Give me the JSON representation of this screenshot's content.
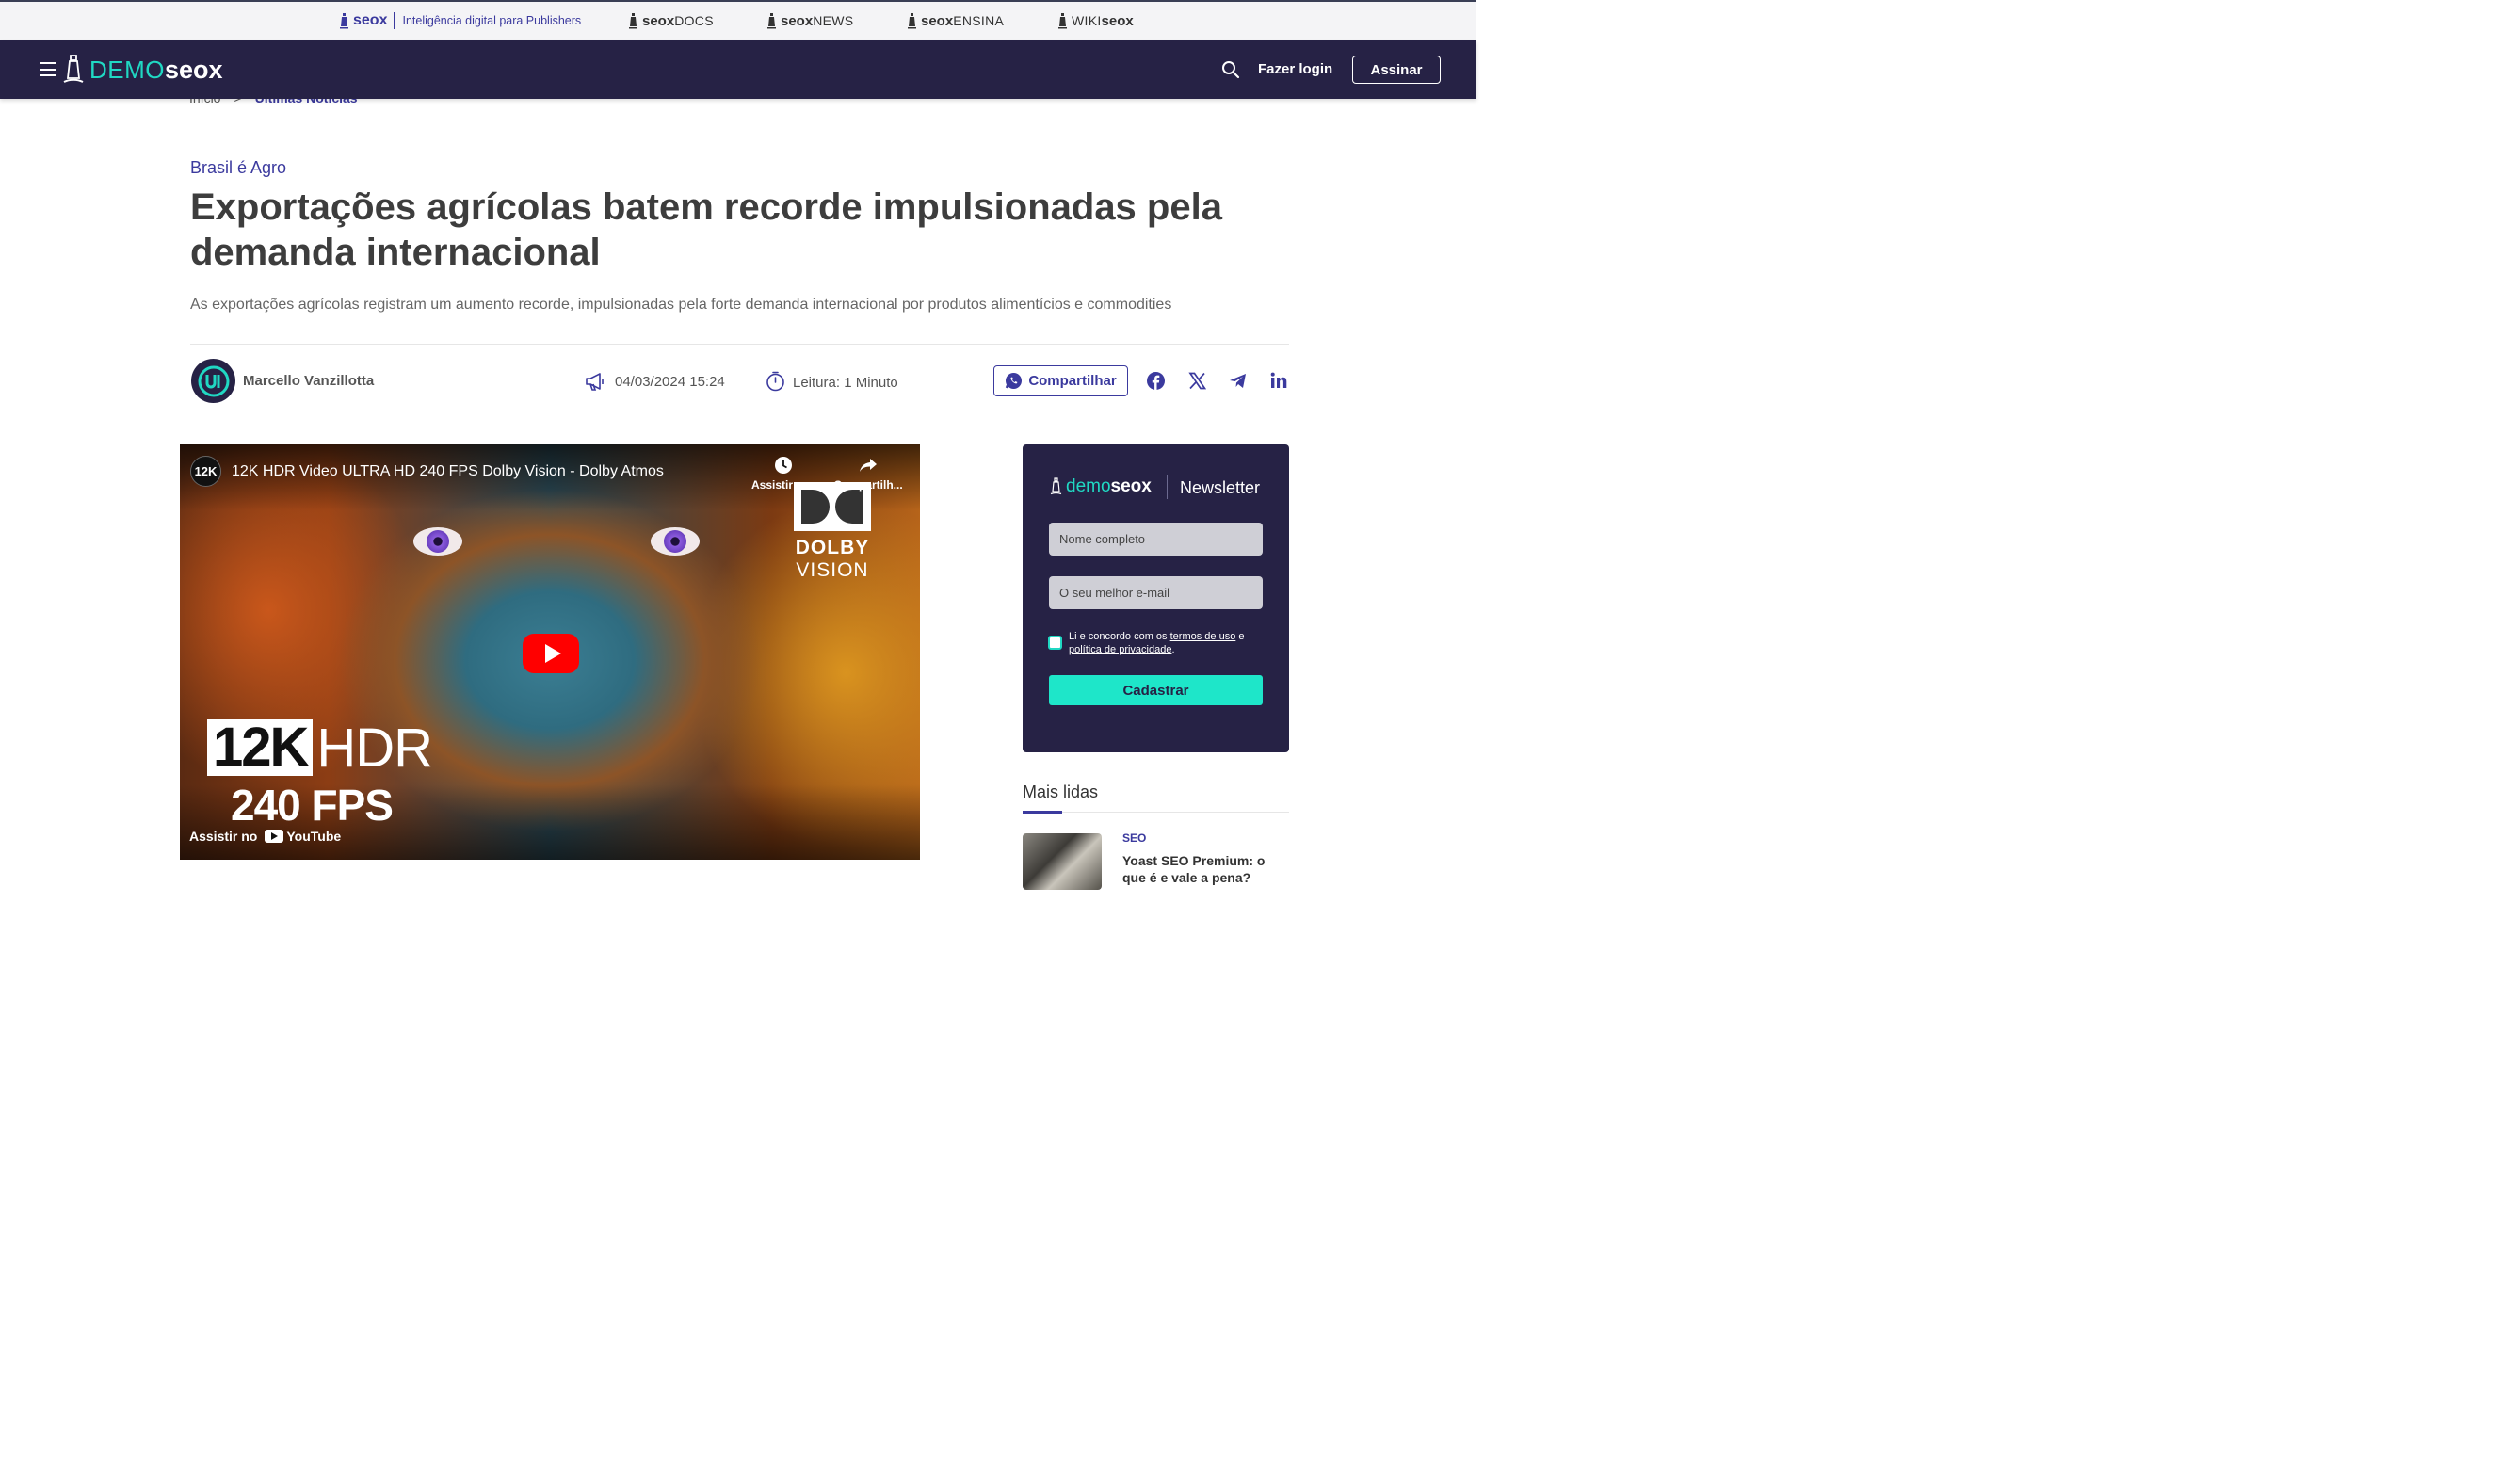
{
  "network_bar": {
    "main_brand": "seox",
    "main_tagline": "Inteligência digital para Publishers",
    "items": [
      {
        "brand": "seox",
        "suffix": "DOCS"
      },
      {
        "brand": "seox",
        "suffix": "NEWS"
      },
      {
        "brand": "seox",
        "suffix": "ENSINA"
      },
      {
        "prefix": "WIKI",
        "brand": "seox"
      }
    ]
  },
  "header": {
    "logo_demo": "DEMO",
    "logo_seox": "seox",
    "login_label": "Fazer login",
    "subscribe_label": "Assinar",
    "icons": [
      "menu-icon",
      "search-icon"
    ]
  },
  "breadcrumb": {
    "home": "Início",
    "separator": ">",
    "current": "Últimas Notícias"
  },
  "article": {
    "category": "Brasil é Agro",
    "title": "Exportações agrícolas batem recorde impulsionadas pela demanda internacional",
    "subtitle": "As exportações agrícolas registram um aumento recorde, impulsionadas pela forte demanda internacional por produtos alimentícios e commodities",
    "author": "Marcello Vanzillotta",
    "datetime": "04/03/2024 15:24",
    "reading_time": "Leitura: 1 Minuto",
    "share_label": "Compartilhar",
    "social_icons": [
      "facebook-icon",
      "x-icon",
      "telegram-icon",
      "linkedin-icon"
    ]
  },
  "video": {
    "channel_badge": "12K",
    "title": "12K HDR Video ULTRA HD 240 FPS Dolby Vision - Dolby Atmos",
    "watch_later_label": "Assistir m...",
    "share_label": "Compartilh...",
    "dolby_line1": "DOLBY",
    "dolby_line2": "VISION",
    "overlay_12k": "12K",
    "overlay_hdr": "HDR",
    "overlay_fps": "240 FPS",
    "watch_on": "Assistir no",
    "youtube": "YouTube"
  },
  "newsletter": {
    "logo_demo": "demo",
    "logo_seox": "seox",
    "title": "Newsletter",
    "name_placeholder": "Nome completo",
    "email_placeholder": "O seu melhor e-mail",
    "terms_prefix": "Li e concordo com os ",
    "terms_link": "termos de uso",
    "terms_and": " e ",
    "privacy_link": "política de privacidade",
    "terms_suffix": ".",
    "submit_label": "Cadastrar"
  },
  "most_read": {
    "title": "Mais lidas",
    "items": [
      {
        "category": "SEO",
        "headline": "Yoast SEO Premium: o que é e vale a pena?"
      }
    ]
  },
  "colors": {
    "navy": "#262245",
    "accent_purple": "#3b3a9e",
    "accent_teal": "#20d8c3",
    "youtube_red": "#ff0000"
  }
}
